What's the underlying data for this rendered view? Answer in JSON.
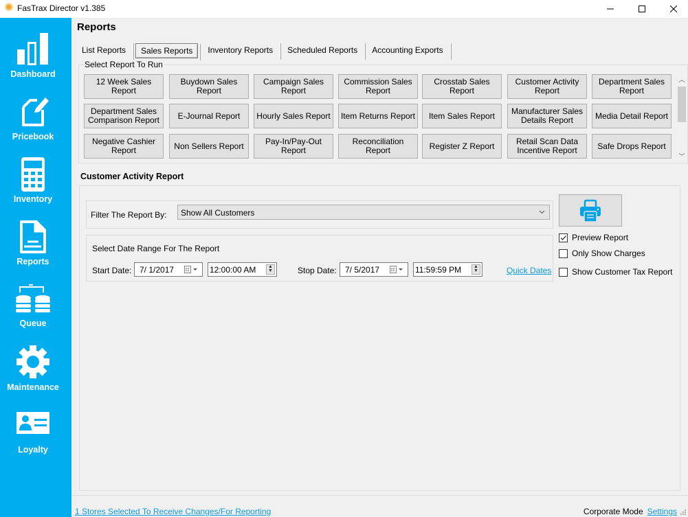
{
  "window": {
    "title": "FasTrax Director v1.385",
    "app_icon": "sun-logo-icon",
    "controls": [
      "minimize",
      "maximize",
      "close"
    ]
  },
  "sidebar": {
    "background": "#00adef",
    "items": [
      {
        "label": "Dashboard",
        "icon": "bar-chart-icon"
      },
      {
        "label": "Pricebook",
        "icon": "document-edit-icon"
      },
      {
        "label": "Inventory",
        "icon": "calculator-icon"
      },
      {
        "label": "Reports",
        "icon": "report-document-icon"
      },
      {
        "label": "Queue",
        "icon": "database-sync-icon"
      },
      {
        "label": "Maintenance",
        "icon": "gear-icon"
      },
      {
        "label": "Loyalty",
        "icon": "id-card-icon"
      }
    ]
  },
  "main": {
    "title": "Reports",
    "tabs": [
      {
        "label": "List Reports",
        "active": false
      },
      {
        "label": "Sales Reports",
        "active": true
      },
      {
        "label": "Inventory Reports",
        "active": false
      },
      {
        "label": "Scheduled Reports",
        "active": false
      },
      {
        "label": "Accounting Exports",
        "active": false
      }
    ],
    "report_group_label": "Select Report To Run",
    "reports": [
      [
        "12 Week Sales\nReport",
        "Buydown Sales\nReport",
        "Campaign Sales\nReport",
        "Commission Sales\nReport",
        "Crosstab Sales\nReport",
        "Customer Activity\nReport",
        "Department Sales\nReport"
      ],
      [
        "Department Sales\nComparison Report",
        "E-Journal Report",
        "Hourly Sales Report",
        "Item Returns Report",
        "Item Sales Report",
        "Manufacturer Sales\nDetails Report",
        "Media Detail Report"
      ],
      [
        "Negative Cashier\nReport",
        "Non Sellers Report",
        "Pay-In/Pay-Out\nReport",
        "Reconciliation Report",
        "Register Z Report",
        "Retail Scan Data\nIncentive Report",
        "Safe Drops Report"
      ]
    ],
    "section_title": "Customer Activity Report",
    "filter": {
      "label": "Filter The Report By:",
      "selected": "Show All Customers"
    },
    "date_range": {
      "header": "Select Date Range For The Report",
      "start_label": "Start Date:",
      "start_date": "7/ 1/2017",
      "start_time": "12:00:00 AM",
      "stop_label": "Stop Date:",
      "stop_date": "7/ 5/2017",
      "stop_time": "11:59:59 PM",
      "quick_dates": "Quick Dates"
    },
    "print_button_icon": "printer-icon",
    "options": [
      {
        "label": "Preview Report",
        "checked": true
      },
      {
        "label": "Only Show Charges",
        "checked": false
      },
      {
        "label": "Show Customer Tax Report",
        "checked": false
      }
    ]
  },
  "status": {
    "stores_link": "1 Stores Selected To Receive Changes/For Reporting",
    "mode": "Corporate Mode",
    "settings_link": "Settings"
  },
  "colors": {
    "accent": "#00adef",
    "link": "#0e9cdc"
  }
}
